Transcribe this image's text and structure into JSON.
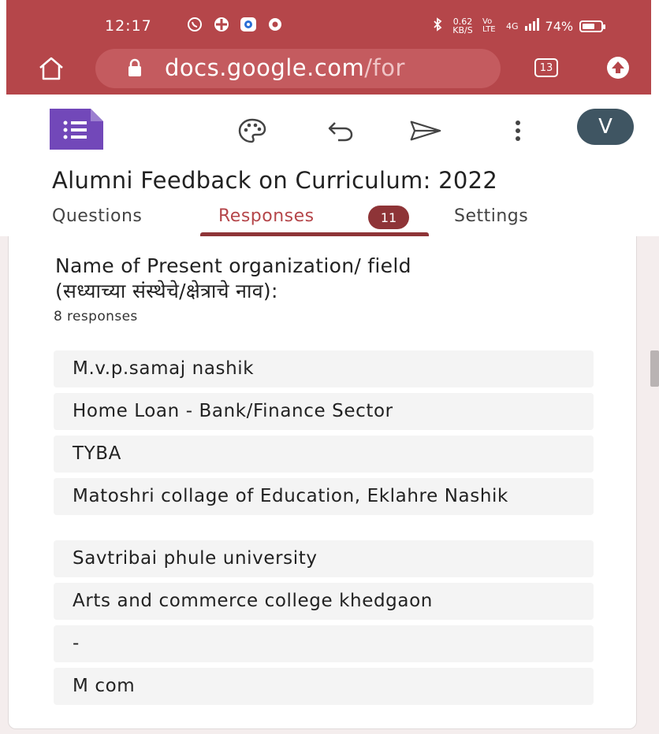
{
  "status_bar": {
    "time": "12:17",
    "network_speed": "0.62 KB/S",
    "lte": "Vo LTE",
    "signal": "4G",
    "battery": "74%",
    "battery_level": 0.74
  },
  "browser": {
    "url_main": "docs.google.com",
    "url_tail": "/for",
    "tabs_count": "13",
    "home_icon": "home-icon",
    "lock_icon": "lock-icon",
    "upload_icon": "upload-icon"
  },
  "toolbar": {
    "app_icon": "google-forms-icon",
    "palette_icon": "palette-icon",
    "undo_icon": "undo-icon",
    "send_icon": "send-icon",
    "more_icon": "more-vert-icon",
    "avatar_letter": "V"
  },
  "form": {
    "title": "Alumni Feedback on Curriculum: 2022"
  },
  "tabs": {
    "questions": "Questions",
    "responses": "Responses",
    "responses_badge": "11",
    "settings": "Settings"
  },
  "question": {
    "title_line1": "Name of Present organization/ field",
    "title_line2": "(सध्याच्या संस्थेचे/क्षेत्राचे नाव):",
    "response_count": "8 responses",
    "answers": [
      "M.v.p.samaj nashik",
      "Home Loan - Bank/Finance Sector",
      "TYBA",
      "Matoshri collage of Education, Eklahre Nashik",
      "Savtribai phule university",
      "Arts and commerce college khedgaon",
      "-",
      "M com"
    ]
  },
  "colors": {
    "browser_bar": "#b5464a",
    "accent": "#8e3437",
    "forms_purple": "#673ab7",
    "avatar": "#3f5562"
  }
}
